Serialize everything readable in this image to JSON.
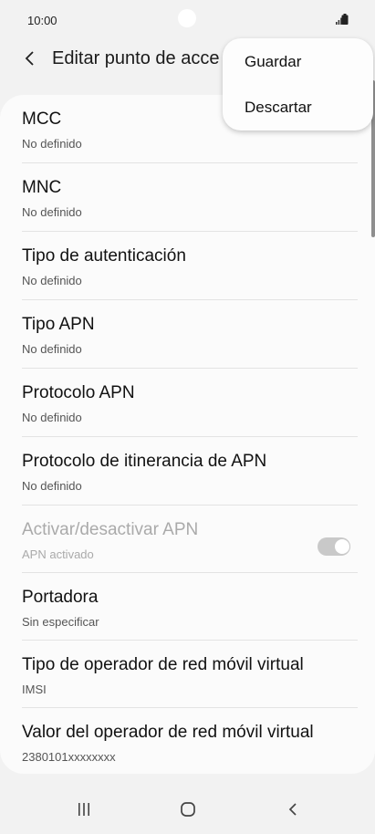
{
  "status_bar": {
    "time": "10:00",
    "icons": [
      "signal-icon",
      "battery-icon"
    ]
  },
  "header": {
    "title": "Editar punto de acce",
    "back_icon": "chevron-left-icon"
  },
  "menu": {
    "items": [
      {
        "label": "Guardar"
      },
      {
        "label": "Descartar"
      }
    ]
  },
  "settings": {
    "items": [
      {
        "title": "MCC",
        "summary": "No definido"
      },
      {
        "title": "MNC",
        "summary": "No definido"
      },
      {
        "title": "Tipo de autenticación",
        "summary": "No definido"
      },
      {
        "title": "Tipo APN",
        "summary": "No definido"
      },
      {
        "title": "Protocolo APN",
        "summary": "No definido"
      },
      {
        "title": "Protocolo de itinerancia de APN",
        "summary": "No definido"
      },
      {
        "title": "Activar/desactivar APN",
        "summary": "APN activado",
        "toggle_on": true,
        "enabled": false
      },
      {
        "title": "Portadora",
        "summary": "Sin especificar"
      },
      {
        "title": "Tipo de operador de red móvil virtual",
        "summary": "IMSI"
      },
      {
        "title": "Valor del operador de red móvil virtual",
        "summary": "2380101xxxxxxxx"
      }
    ]
  },
  "nav_bar": {
    "icons": [
      "recent-apps-icon",
      "home-icon",
      "back-icon"
    ]
  },
  "colors": {
    "background": "#f2f2f2",
    "card": "#fbfbfb",
    "toggle_disabled": "#c9c9c9"
  }
}
